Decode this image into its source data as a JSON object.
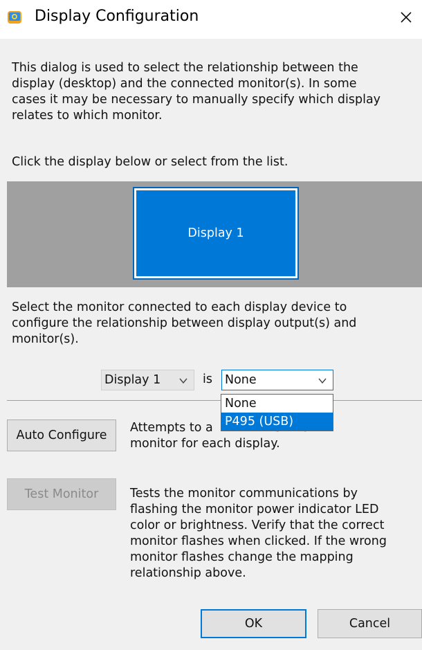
{
  "window": {
    "title": "Display Configuration",
    "close_icon": "close-icon",
    "app_icon": "display-config-app-icon"
  },
  "intro_text": "This dialog is used to select the relationship between the\ndisplay (desktop) and the connected monitor(s). In some\ncases it may be necessary to manually specify which display\nrelates to which monitor.",
  "instruction_text": "Click the display below or select from the list.",
  "display_area": {
    "tiles": [
      {
        "label": "Display 1",
        "selected": true
      }
    ],
    "colors": {
      "background": "#a0a0a0",
      "tile": "#0078d7",
      "tile_text": "#ffffff"
    }
  },
  "select_text": "Select the monitor connected to each display device to\nconfigure the relationship between display output(s) and\nmonitor(s).",
  "mapping": {
    "display_selected": "Display 1",
    "is_label": "is",
    "monitor_selected": "None",
    "dropdown_open": true,
    "monitor_options": [
      "None",
      "P495 (USB)"
    ],
    "highlighted_option": "P495 (USB)"
  },
  "auto_configure": {
    "button_label": "Auto Configure",
    "description_visible": "Attempts to a     ct the\nmonitor for each display."
  },
  "test_monitor": {
    "button_label": "Test Monitor",
    "enabled": false,
    "description": "Tests the monitor communications by\nflashing the monitor power indicator LED\ncolor or brightness. Verify that the correct\nmonitor flashes when clicked. If the wrong\nmonitor flashes change the mapping\nrelationship above."
  },
  "footer": {
    "ok_label": "OK",
    "cancel_label": "Cancel"
  },
  "colors": {
    "accent": "#0078d7",
    "dialog_bg": "#f0f0f0",
    "disabled_text": "#8a8a8a"
  }
}
